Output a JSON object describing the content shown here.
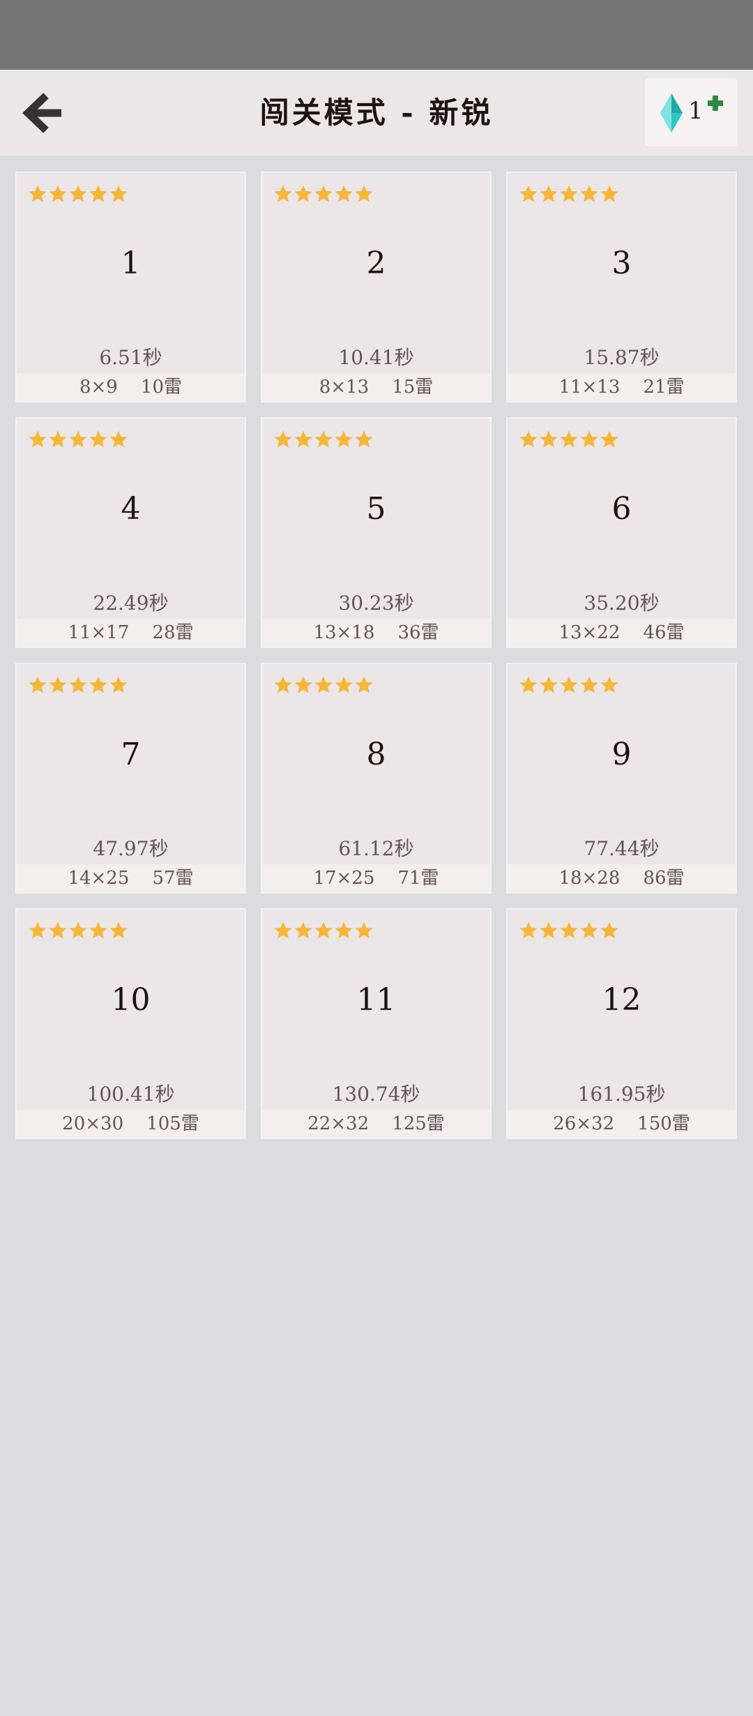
{
  "header": {
    "title": "闯关模式 - 新锐",
    "gem_count": "1",
    "icons": {
      "back": "back-arrow-icon",
      "gem": "gem-icon",
      "add": "plus-icon"
    },
    "colors": {
      "gem": "#2fc7c4",
      "plus": "#2e8b3e",
      "star": "#f6b637"
    }
  },
  "levels": [
    {
      "number": "1",
      "stars": 5,
      "time": "6.51秒",
      "info": "8×9    10雷"
    },
    {
      "number": "2",
      "stars": 5,
      "time": "10.41秒",
      "info": "8×13    15雷"
    },
    {
      "number": "3",
      "stars": 5,
      "time": "15.87秒",
      "info": "11×13    21雷"
    },
    {
      "number": "4",
      "stars": 5,
      "time": "22.49秒",
      "info": "11×17    28雷"
    },
    {
      "number": "5",
      "stars": 5,
      "time": "30.23秒",
      "info": "13×18    36雷"
    },
    {
      "number": "6",
      "stars": 5,
      "time": "35.20秒",
      "info": "13×22    46雷"
    },
    {
      "number": "7",
      "stars": 5,
      "time": "47.97秒",
      "info": "14×25    57雷"
    },
    {
      "number": "8",
      "stars": 5,
      "time": "61.12秒",
      "info": "17×25    71雷"
    },
    {
      "number": "9",
      "stars": 5,
      "time": "77.44秒",
      "info": "18×28    86雷"
    },
    {
      "number": "10",
      "stars": 5,
      "time": "100.41秒",
      "info": "20×30    105雷"
    },
    {
      "number": "11",
      "stars": 5,
      "time": "130.74秒",
      "info": "22×32    125雷"
    },
    {
      "number": "12",
      "stars": 5,
      "time": "161.95秒",
      "info": "26×32    150雷"
    }
  ]
}
